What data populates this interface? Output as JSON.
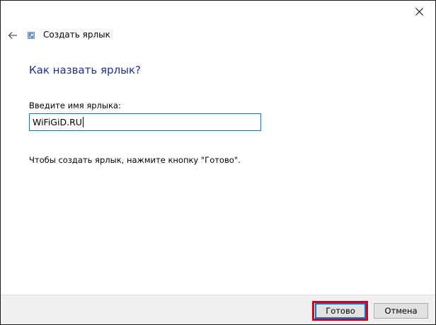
{
  "window": {
    "title": "Создать ярлык",
    "close_icon": "close-icon",
    "back_icon": "back-arrow-icon",
    "wizard_icon": "shortcut-icon"
  },
  "main": {
    "heading": "Как назвать ярлык?",
    "name_label": "Введите имя ярлыка:",
    "name_value": "WiFiGiD.RU",
    "hint": "Чтобы создать ярлык, нажмите кнопку \"Готово\"."
  },
  "footer": {
    "finish_label": "Готово",
    "cancel_label": "Отмена"
  },
  "colors": {
    "heading": "#1e3287",
    "focus_border": "#0078d7",
    "highlight": "#d0021b",
    "footer_bg": "#f0f0f0"
  }
}
